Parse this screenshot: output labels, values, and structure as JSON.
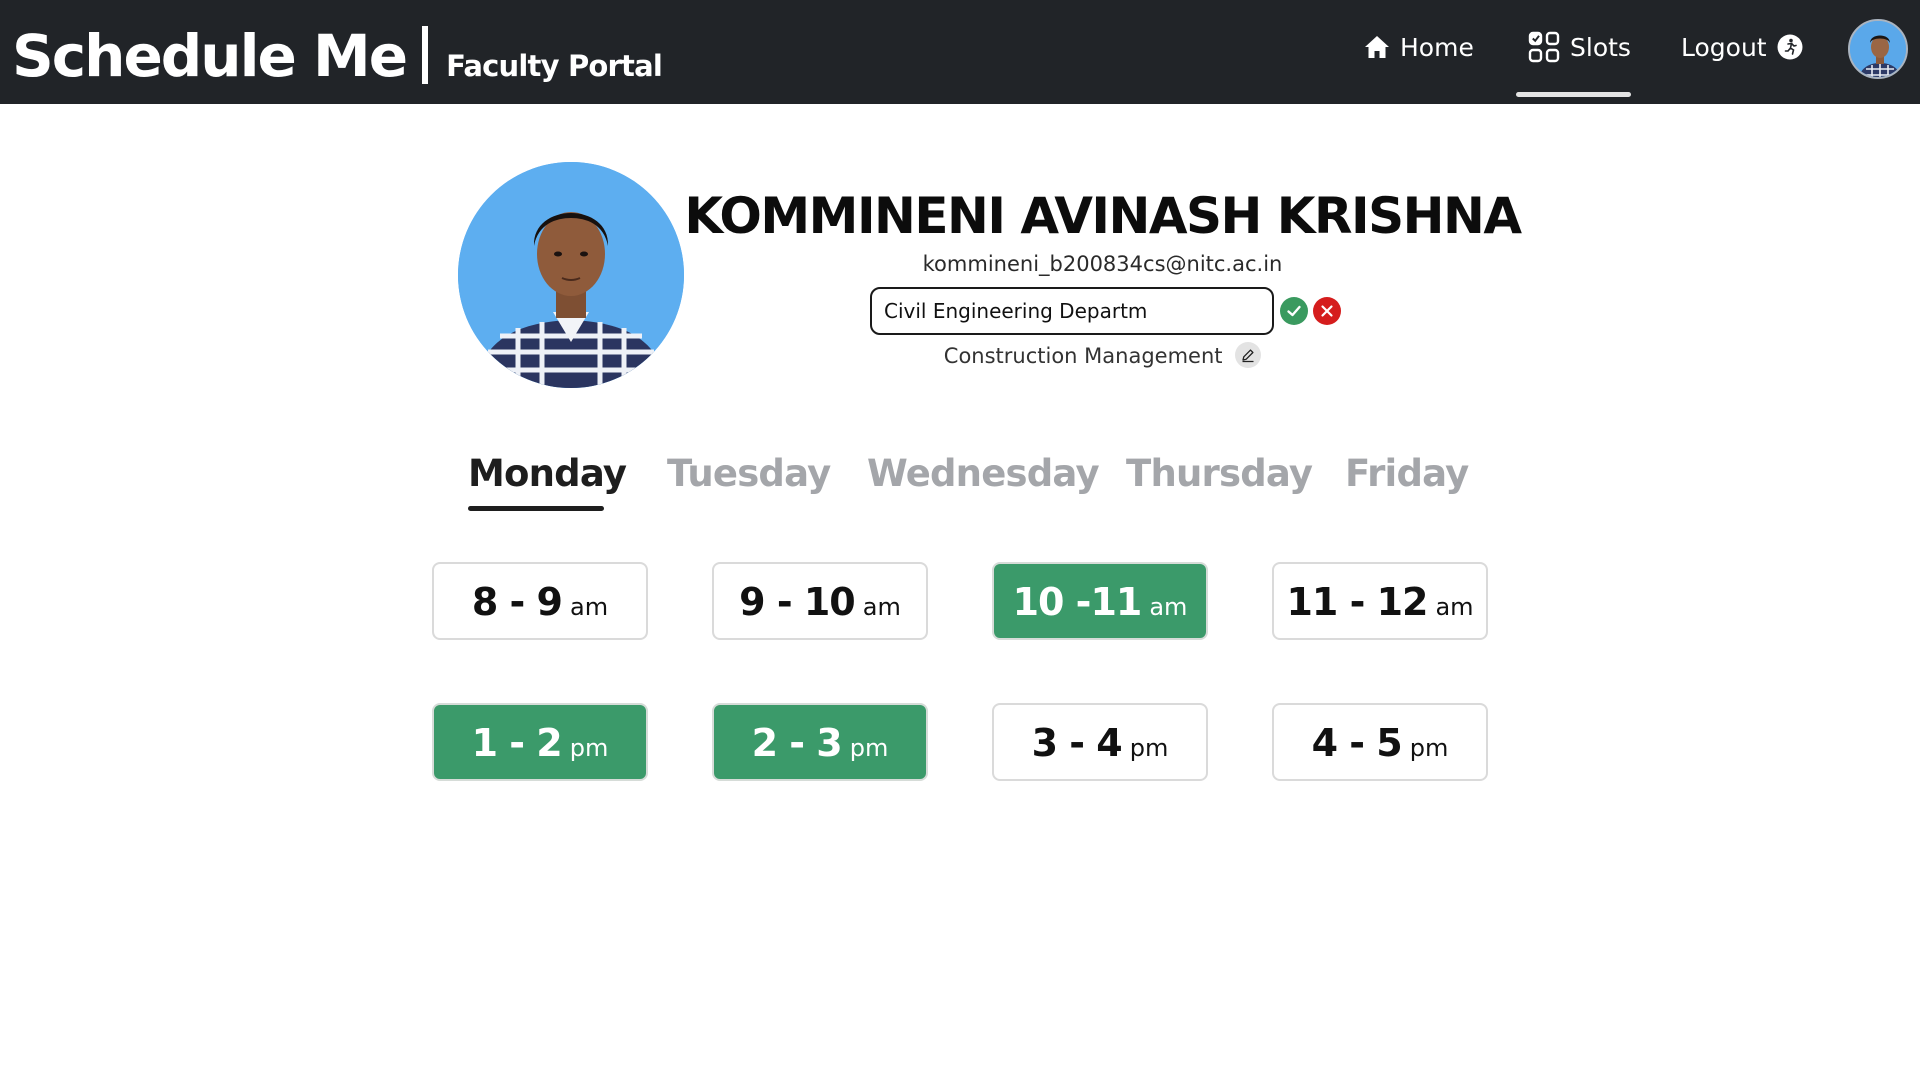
{
  "navbar": {
    "title": "Schedule Me",
    "subtitle": "Faculty Portal",
    "items": [
      {
        "label": "Home",
        "icon": "home-icon"
      },
      {
        "label": "Slots",
        "icon": "grid-icon",
        "active": true
      },
      {
        "label": "Logout",
        "icon": "logout-icon"
      }
    ],
    "avatar_icon": "user-avatar"
  },
  "profile": {
    "name": "KOMMINENI AVINASH KRISHNA",
    "email": "kommineni_b200834cs@nitc.ac.in",
    "department_value": "Civil Engineering Departm",
    "specialization": "Construction Management"
  },
  "days": [
    "Monday",
    "Tuesday",
    "Wednesday",
    "Thursday",
    "Friday"
  ],
  "active_day": "Monday",
  "slots": [
    {
      "time": "8 - 9",
      "unit": "am",
      "selected": false
    },
    {
      "time": "9 - 10",
      "unit": "am",
      "selected": false
    },
    {
      "time": "10 -11",
      "unit": "am",
      "selected": true
    },
    {
      "time": "11 - 12",
      "unit": "am",
      "selected": false
    },
    {
      "time": "1 - 2",
      "unit": "pm",
      "selected": true
    },
    {
      "time": "2 - 3",
      "unit": "pm",
      "selected": true
    },
    {
      "time": "3 - 4",
      "unit": "pm",
      "selected": false
    },
    {
      "time": "4 - 5",
      "unit": "pm",
      "selected": false
    }
  ],
  "colors": {
    "navbar_bg": "#212428",
    "slot_selected": "#3b9a6a",
    "confirm": "#3a9a5f",
    "cancel": "#d51d1d",
    "tab_inactive": "#a4a6aa"
  }
}
